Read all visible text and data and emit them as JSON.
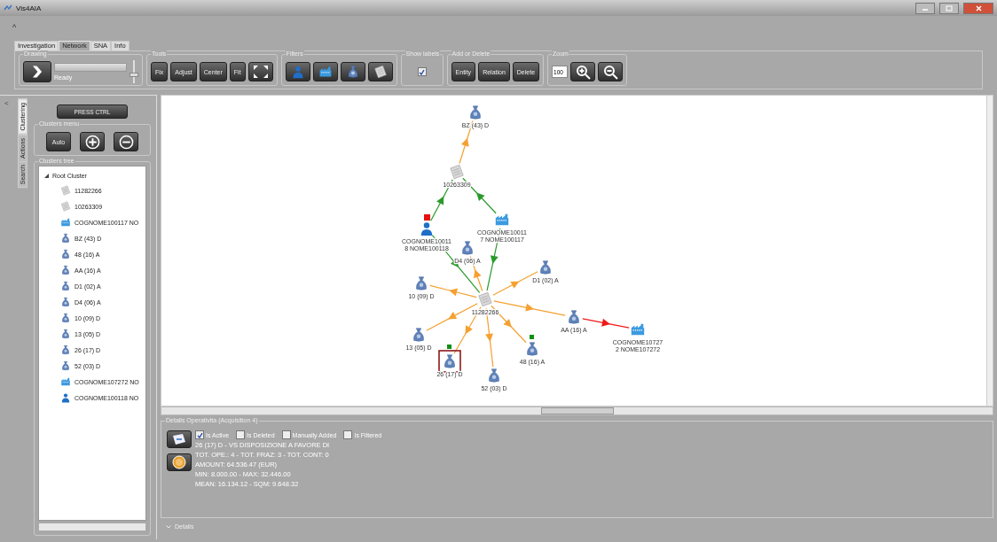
{
  "window": {
    "title": "Vis4AIA",
    "collapse_glyph": "^"
  },
  "tabs": [
    {
      "label": "Investigation",
      "selected": false
    },
    {
      "label": "Network",
      "selected": true
    },
    {
      "label": "SNA",
      "selected": false
    },
    {
      "label": "Info",
      "selected": false
    }
  ],
  "ribbon": {
    "drawing": {
      "title": "Drawing",
      "status": "Ready",
      "progress": {
        "level": 1
      },
      "slider": {
        "level": 0.35
      }
    },
    "tools": {
      "title": "Tools",
      "buttons": [
        "Fix",
        "Adjust",
        "Center",
        "Fit"
      ]
    },
    "filters": {
      "title": "Filters",
      "buttons": [
        {
          "kind": "person"
        },
        {
          "kind": "factory"
        },
        {
          "kind": "bag"
        },
        {
          "kind": "document"
        }
      ]
    },
    "show_labels": {
      "title": "Show labels",
      "checked": true
    },
    "add_delete": {
      "title": "Add or Delete",
      "buttons": [
        "Entity",
        "Relation",
        "Delete"
      ]
    },
    "zoom": {
      "title": "Zoom",
      "value": "100"
    }
  },
  "side_panel": {
    "collapse_glyph": "<",
    "tabs": [
      {
        "label": "Clustering",
        "selected": true
      },
      {
        "label": "Actions",
        "selected": false
      },
      {
        "label": "Search",
        "selected": false
      }
    ],
    "press_button": "PRESS CTRL",
    "clusters_menu": {
      "title": "Clusters menu",
      "auto": "Auto"
    },
    "clusters_tree": {
      "title": "Clusters tree",
      "root": {
        "label": "Root Cluster",
        "expanded": true,
        "children": [
          {
            "label": "11282266",
            "kind": "document"
          },
          {
            "label": "10263309",
            "kind": "document"
          },
          {
            "label": "COGNOME100117 NO",
            "kind": "factory"
          },
          {
            "label": "BZ (43) D",
            "kind": "bag"
          },
          {
            "label": "48 (16) A",
            "kind": "bag"
          },
          {
            "label": "AA (16) A",
            "kind": "bag"
          },
          {
            "label": "D1 (02) A",
            "kind": "bag"
          },
          {
            "label": "D4 (06) A",
            "kind": "bag"
          },
          {
            "label": "10 (09) D",
            "kind": "bag"
          },
          {
            "label": "13 (05) D",
            "kind": "bag"
          },
          {
            "label": "26 (17) D",
            "kind": "bag"
          },
          {
            "label": "52 (03) D",
            "kind": "bag"
          },
          {
            "label": "COGNOME107272 NO",
            "kind": "factory"
          },
          {
            "label": "COGNOME100118 NO",
            "kind": "person"
          }
        ]
      }
    }
  },
  "graph": {
    "nodes": [
      {
        "kind": "bag",
        "label_lines": [
          "BZ (43) D"
        ],
        "selected": false
      },
      {
        "kind": "document",
        "label_lines": [
          "10263309"
        ],
        "selected": false
      },
      {
        "kind": "person",
        "label_lines": [
          "COGNOME10011",
          "8 NOME100118"
        ],
        "selected": false,
        "color": "#e81010"
      },
      {
        "kind": "factory",
        "label_lines": [
          "COGNOME10011",
          "7 NOME100117"
        ],
        "selected": false
      },
      {
        "kind": "bag",
        "label_lines": [
          "D4 (06) A"
        ],
        "selected": false
      },
      {
        "kind": "bag",
        "label_lines": [
          "D1 (02) A"
        ],
        "selected": false
      },
      {
        "kind": "bag",
        "label_lines": [
          "10 (09) D"
        ],
        "selected": false
      },
      {
        "kind": "document",
        "label_lines": [
          "11282266"
        ],
        "selected": false
      },
      {
        "kind": "bag",
        "label_lines": [
          "13 (05) D"
        ],
        "selected": false
      },
      {
        "kind": "bag",
        "label_lines": [
          "AA (16) A"
        ],
        "selected": false
      },
      {
        "kind": "factory",
        "label_lines": [
          "COGNOME10727",
          "2 NOME107272"
        ],
        "selected": false
      },
      {
        "kind": "bag",
        "label_lines": [
          "26 (17) D"
        ],
        "selected": true,
        "color": "#109010"
      },
      {
        "kind": "bag",
        "label_lines": [
          "48 (16) A"
        ],
        "selected": false,
        "color": "#109010"
      },
      {
        "kind": "bag",
        "label_lines": [
          "52 (03) D"
        ],
        "selected": false
      }
    ],
    "edges": [
      {
        "color": "#f5a030"
      },
      {
        "color": "#2a9a2a"
      },
      {
        "color": "#2a9a2a"
      },
      {
        "color": "#2a9a2a"
      },
      {
        "color": "#2a9a2a"
      },
      {
        "color": "#f5a030"
      },
      {
        "color": "#f5a030"
      },
      {
        "color": "#f5a030"
      },
      {
        "color": "#f5a030"
      },
      {
        "color": "#f5a030"
      },
      {
        "color": "#f5a030"
      },
      {
        "color": "#f5a030"
      },
      {
        "color": "#f5a030"
      },
      {
        "color": "#f01818"
      }
    ]
  },
  "details": {
    "title": "Details Operativita (Acquisition 4)",
    "checks": [
      {
        "label": "Is Active",
        "checked": true
      },
      {
        "label": "Is Deleted",
        "checked": false
      },
      {
        "label": "Manually Added",
        "checked": false
      },
      {
        "label": "Is Filtered",
        "checked": false
      }
    ],
    "lines": [
      "26 (17) D - VS DISPOSIZIONE A FAVORE DI",
      "TOT. OPE.: 4 - TOT. FRAZ: 3 - TOT. CONT: 0",
      "AMOUNT: 64.536.47 (EUR)",
      "MIN: 8.000.00 - MAX: 32.446.00",
      "MEAN: 16.134.12 - SQM: 9.648.32"
    ],
    "footer": "Details"
  }
}
